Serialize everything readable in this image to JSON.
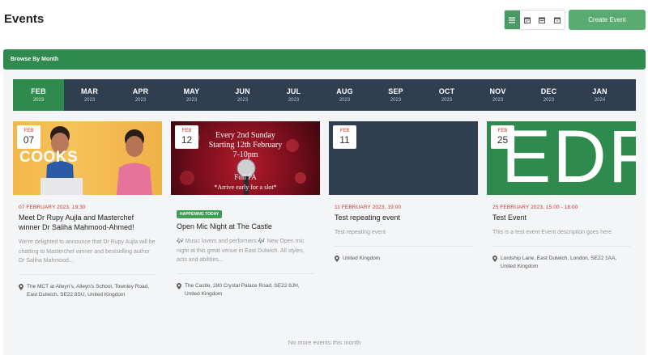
{
  "header": {
    "title": "Events",
    "create_label": "Create Event"
  },
  "view_icons": [
    "list-icon",
    "calendar-month-icon",
    "calendar-week-icon",
    "calendar-day-icon"
  ],
  "browse": {
    "label": "Browse By Month"
  },
  "months": [
    {
      "m": "FEB",
      "y": "2023"
    },
    {
      "m": "MAR",
      "y": "2023"
    },
    {
      "m": "APR",
      "y": "2023"
    },
    {
      "m": "MAY",
      "y": "2023"
    },
    {
      "m": "JUN",
      "y": "2023"
    },
    {
      "m": "JUL",
      "y": "2023"
    },
    {
      "m": "AUG",
      "y": "2023"
    },
    {
      "m": "SEP",
      "y": "2023"
    },
    {
      "m": "OCT",
      "y": "2023"
    },
    {
      "m": "NOV",
      "y": "2023"
    },
    {
      "m": "DEC",
      "y": "2023"
    },
    {
      "m": "JAN",
      "y": "2024"
    }
  ],
  "events": [
    {
      "badge_month": "FEB",
      "badge_day": "07",
      "when": "07 FEBRUARY 2023, 19:30",
      "title": "Meet Dr Rupy Aujla and Masterchef winner Dr Saliha Mahmood-Ahmed!",
      "desc": "We're delighted to announce that Dr Rupy Aujla will be chatting to Masterchef winner and bestselling author Dr Saliha Mahmood...",
      "location": "The MCT at Alleyn's, Alleyn's School, Townley Road, East Dulwich, SE22 8SU, United Kingdom",
      "img_text": "COOKS"
    },
    {
      "badge_month": "FEB",
      "badge_day": "12",
      "tag": "HAPPENING TODAY",
      "title": "Open Mic Night at The Castle",
      "desc": "🎶 Music lovers and performers 🎶 New Open mic night at this great venue in East Dulwich. All styles, acts and abilities...",
      "location": "The Castle, 280 Crystal Palace Road, SE22 9JH, United Kingdom",
      "img_line1": "Every 2nd Sunday",
      "img_line2": "Starting 12th February",
      "img_line3": "7-10pm",
      "img_line4": "Full PA",
      "img_line5": "*Arrive early for a slot*"
    },
    {
      "badge_month": "FEB",
      "badge_day": "11",
      "when": "11 FEBRUARY 2023, 19:00",
      "title": "Test repeating event",
      "desc": "Test repeating event",
      "location": "United Kingdom"
    },
    {
      "badge_month": "FEB",
      "badge_day": "25",
      "when": "25 FEBRUARY 2023, 15:00 - 18:00",
      "title": "Test Event",
      "desc": "This is a test event Event description goes here",
      "location": "Lordship Lane, East Dulwich, London, SE22 1AA, United Kingdom",
      "img_text": "EDF"
    }
  ],
  "footer": {
    "no_more": "No more events this month"
  },
  "colors": {
    "brand_green": "#2f8a4d",
    "month_bar": "#2f3f50",
    "date_red": "#c0392b"
  }
}
